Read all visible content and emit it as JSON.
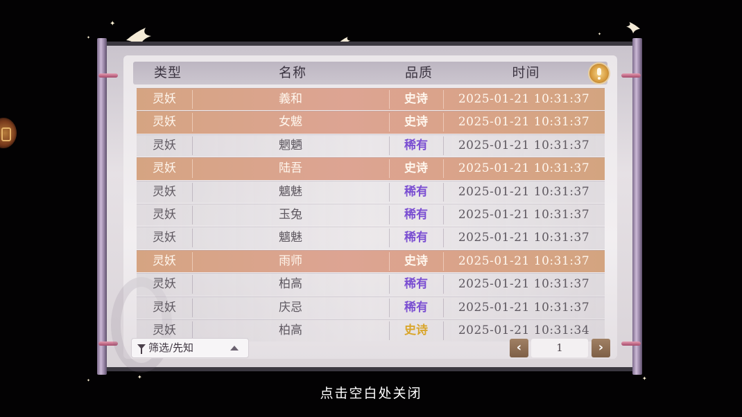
{
  "table": {
    "headers": [
      "类型",
      "名称",
      "品质",
      "时间"
    ],
    "rows": [
      {
        "type": "灵妖",
        "name": "義和",
        "quality": "史诗",
        "time": "2025-01-21  10:31:37",
        "style": "epic"
      },
      {
        "type": "灵妖",
        "name": "女魃",
        "quality": "史诗",
        "time": "2025-01-21  10:31:37",
        "style": "epic"
      },
      {
        "type": "灵妖",
        "name": "魍魉",
        "quality": "稀有",
        "time": "2025-01-21  10:31:37",
        "style": "rare"
      },
      {
        "type": "灵妖",
        "name": "陆吾",
        "quality": "史诗",
        "time": "2025-01-21  10:31:37",
        "style": "epic"
      },
      {
        "type": "灵妖",
        "name": "魑魅",
        "quality": "稀有",
        "time": "2025-01-21  10:31:37",
        "style": "rare"
      },
      {
        "type": "灵妖",
        "name": "玉兔",
        "quality": "稀有",
        "time": "2025-01-21  10:31:37",
        "style": "rare"
      },
      {
        "type": "灵妖",
        "name": "魑魅",
        "quality": "稀有",
        "time": "2025-01-21  10:31:37",
        "style": "rare"
      },
      {
        "type": "灵妖",
        "name": "雨师",
        "quality": "史诗",
        "time": "2025-01-21  10:31:37",
        "style": "epic"
      },
      {
        "type": "灵妖",
        "name": "柏高",
        "quality": "稀有",
        "time": "2025-01-21  10:31:37",
        "style": "rare"
      },
      {
        "type": "灵妖",
        "name": "庆忌",
        "quality": "稀有",
        "time": "2025-01-21  10:31:37",
        "style": "rare"
      },
      {
        "type": "灵妖",
        "name": "柏高",
        "quality": "史诗",
        "time": "2025-01-21  10:31:34",
        "style": "epic-plain"
      }
    ]
  },
  "filter": {
    "label": "筛选/先知"
  },
  "pagination": {
    "current_page": "1",
    "prev_icon": "‹",
    "next_icon": "›"
  },
  "footer": {
    "close_hint": "点击空白处关闭"
  },
  "icons": {
    "help": "lightbulb-icon",
    "filter": "funnel-icon",
    "expand": "triangle-up-icon",
    "prev": "chevron-left-icon",
    "next": "chevron-right-icon"
  },
  "colors": {
    "epic_row": "#dba38c",
    "rare_text": "#7b4fd2",
    "epic_gold_text": "#d9a52a",
    "page_button": "#8e6d52"
  }
}
